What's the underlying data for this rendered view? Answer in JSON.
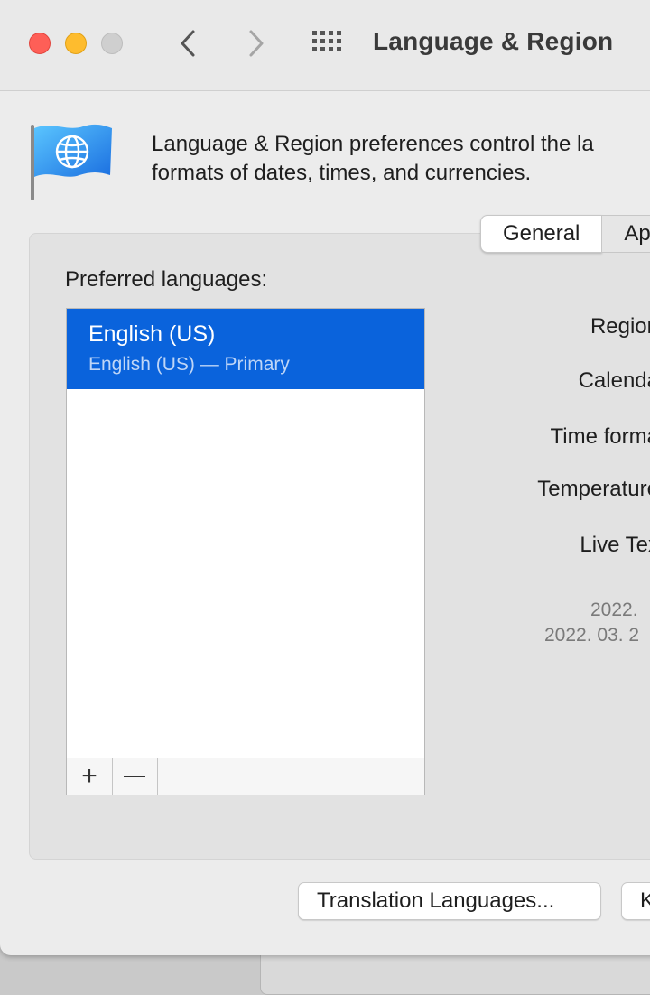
{
  "window": {
    "title": "Language & Region"
  },
  "header": {
    "description_line1": "Language & Region preferences control the la",
    "description_line2": "formats of dates, times, and currencies."
  },
  "tabs": [
    {
      "label": "General",
      "active": true
    },
    {
      "label": "Ap",
      "active": false
    }
  ],
  "languages": {
    "label": "Preferred languages:",
    "items": [
      {
        "name": "English (US)",
        "subtitle": "English (US) — Primary",
        "selected": true
      }
    ],
    "add_symbol": "+",
    "remove_symbol": "—"
  },
  "fields": {
    "region": "Region",
    "calendar": "Calenda",
    "time_format": "Time forma",
    "temperature": "Temperature",
    "live_text": "Live Tex"
  },
  "samples": {
    "line1": "2022.",
    "line2": "2022. 03. 2"
  },
  "buttons": {
    "translation_languages": "Translation Languages...",
    "keyboard_partial": "K"
  },
  "icons": {
    "flag": "globe-flag-icon",
    "back": "chevron-left-icon",
    "forward": "chevron-right-icon",
    "grid": "grid-icon"
  },
  "colors": {
    "selection": "#0a63dc",
    "close": "#fe5f57",
    "minimize": "#febc2e"
  }
}
